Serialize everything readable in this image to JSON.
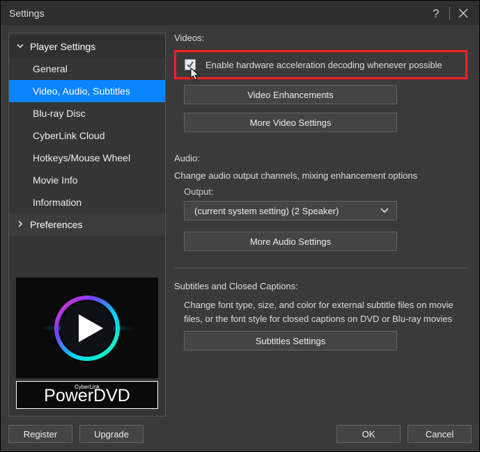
{
  "window": {
    "title": "Settings"
  },
  "sidebar": {
    "group1": {
      "label": "Player Settings"
    },
    "items": [
      {
        "label": "General"
      },
      {
        "label": "Video, Audio, Subtitles"
      },
      {
        "label": "Blu-ray Disc"
      },
      {
        "label": "CyberLink Cloud"
      },
      {
        "label": "Hotkeys/Mouse Wheel"
      },
      {
        "label": "Movie Info"
      },
      {
        "label": "Information"
      }
    ],
    "group2": {
      "label": "Preferences"
    },
    "brand": {
      "small": "CyberLink",
      "big": "PowerDVD"
    }
  },
  "videos": {
    "heading": "Videos:",
    "hwaccel_label": "Enable hardware acceleration decoding whenever possible",
    "btn_enhance": "Video Enhancements",
    "btn_more": "More Video Settings"
  },
  "audio": {
    "heading": "Audio:",
    "desc": "Change audio output channels, mixing enhancement options",
    "output_label": "Output:",
    "output_value": "(current system setting) (2 Speaker)",
    "btn_more": "More Audio Settings"
  },
  "subs": {
    "heading": "Subtitles and Closed Captions:",
    "desc": "Change font type, size, and color for external subtitle files on movie files, or the font style for closed captions on DVD or Blu-ray movies",
    "btn": "Subtitles Settings"
  },
  "footer": {
    "register": "Register",
    "upgrade": "Upgrade",
    "ok": "OK",
    "cancel": "Cancel"
  }
}
